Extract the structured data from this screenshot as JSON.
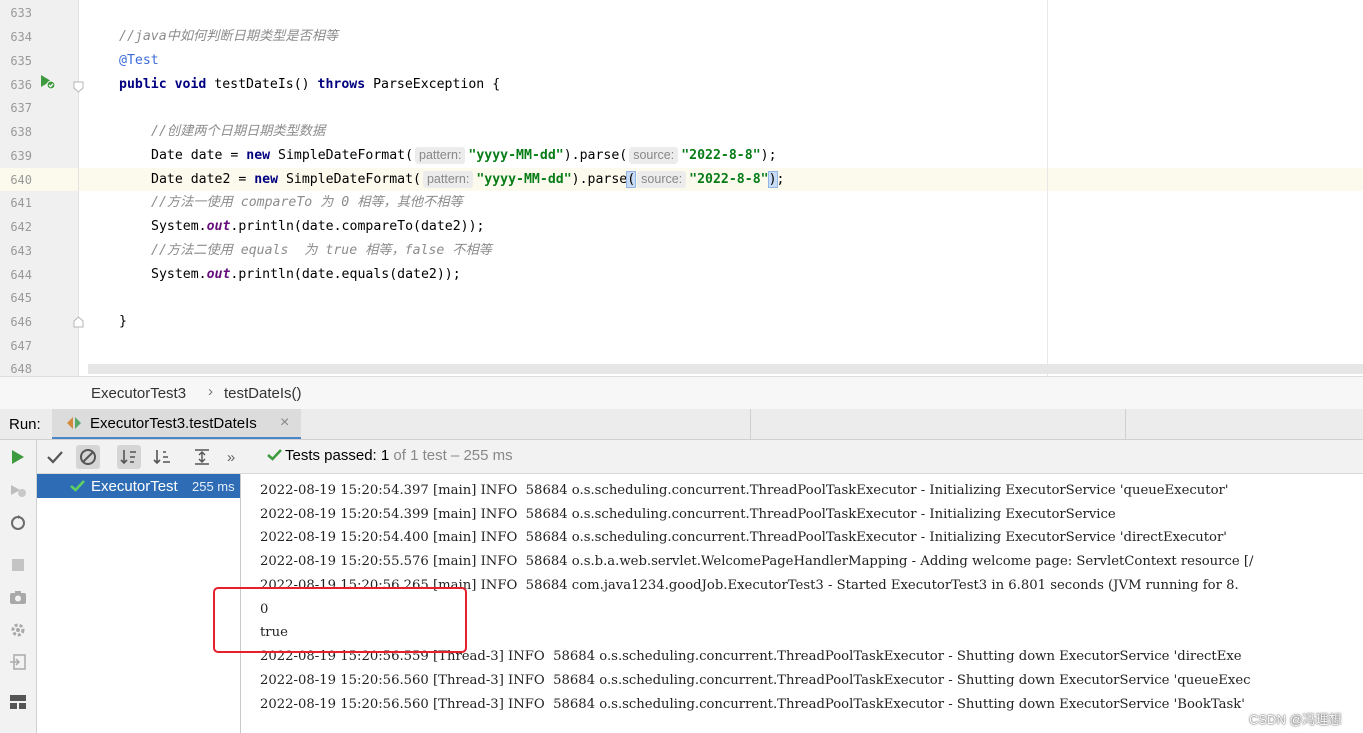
{
  "editor": {
    "line_numbers": [
      "633",
      "634",
      "635",
      "636",
      "637",
      "638",
      "639",
      "640",
      "641",
      "642",
      "643",
      "644",
      "645",
      "646",
      "647",
      "648"
    ],
    "lines": {
      "l634_comment": "//java中如何判断日期类型是否相等",
      "l635_annotation": "@Test",
      "l636_public": "public",
      "l636_void": "void",
      "l636_name": " testDateIs() ",
      "l636_throws": "throws",
      "l636_rest": " ParseException {",
      "l638_comment": "//创建两个日期日期类型数据",
      "l639_a": "Date date = ",
      "l639_new": "new",
      "l639_b": " SimpleDateFormat(",
      "l639_hint_pattern": "pattern:",
      "l639_str_pattern": "\"yyyy-MM-dd\"",
      "l639_c": ").parse(",
      "l639_hint_source": "source:",
      "l639_str_source": "\"2022-8-8\"",
      "l639_d": ");",
      "l640_a": "Date date2 = ",
      "l640_new": "new",
      "l640_b": " SimpleDateFormat(",
      "l640_hint_pattern": "pattern:",
      "l640_str_pattern": "\"yyyy-MM-dd\"",
      "l640_c": ").parse",
      "l640_paren_open": "(",
      "l640_hint_source": "source:",
      "l640_str_source": "\"2022-8-8\"",
      "l640_paren_close": ")",
      "l640_d": ";",
      "l641_comment": "//方法一使用 compareTo 为 0 相等，其他不相等",
      "l642_a": "System.",
      "l642_out": "out",
      "l642_b": ".println(date.compareTo(date2));",
      "l643_comment": "//方法二使用 equals  为 true 相等，false 不相等",
      "l644_a": "System.",
      "l644_out": "out",
      "l644_b": ".println(date.equals(date2));",
      "l646_brace": "}"
    }
  },
  "breadcrumb": {
    "class_name": "ExecutorTest3",
    "separator": "›",
    "method_name": "testDateIs()"
  },
  "run_window": {
    "label": "Run:",
    "tab_label": "ExecutorTest3.testDateIs",
    "tab_close": "×"
  },
  "test_toolbar": {
    "more": "»",
    "passed_label": "Tests passed: ",
    "passed_count": "1",
    "passed_rest": " of 1 test – 255 ms"
  },
  "test_tree": {
    "item_label": "ExecutorTest",
    "item_time": "255 ms"
  },
  "console": {
    "lines": [
      "2022-08-19 15:20:54.397 [main] INFO  58684 o.s.scheduling.concurrent.ThreadPoolTaskExecutor - Initializing ExecutorService 'queueExecutor'",
      "2022-08-19 15:20:54.399 [main] INFO  58684 o.s.scheduling.concurrent.ThreadPoolTaskExecutor - Initializing ExecutorService",
      "2022-08-19 15:20:54.400 [main] INFO  58684 o.s.scheduling.concurrent.ThreadPoolTaskExecutor - Initializing ExecutorService 'directExecutor'",
      "2022-08-19 15:20:55.576 [main] INFO  58684 o.s.b.a.web.servlet.WelcomePageHandlerMapping - Adding welcome page: ServletContext resource [/",
      "2022-08-19 15:20:56.265 [main] INFO  58684 com.java1234.goodJob.ExecutorTest3 - Started ExecutorTest3 in 6.801 seconds (JVM running for 8.",
      "0",
      "true",
      "2022-08-19 15:20:56.559 [Thread-3] INFO  58684 o.s.scheduling.concurrent.ThreadPoolTaskExecutor - Shutting down ExecutorService 'directExe",
      "2022-08-19 15:20:56.560 [Thread-3] INFO  58684 o.s.scheduling.concurrent.ThreadPoolTaskExecutor - Shutting down ExecutorService 'queueExec",
      "2022-08-19 15:20:56.560 [Thread-3] INFO  58684 o.s.scheduling.concurrent.ThreadPoolTaskExecutor - Shutting down ExecutorService 'BookTask'"
    ]
  },
  "watermark": "CSDN @冯理想",
  "colors": {
    "accent": "#2e6db5",
    "pass_green": "#3e9a3e",
    "highlight_box": "#e8202a"
  }
}
